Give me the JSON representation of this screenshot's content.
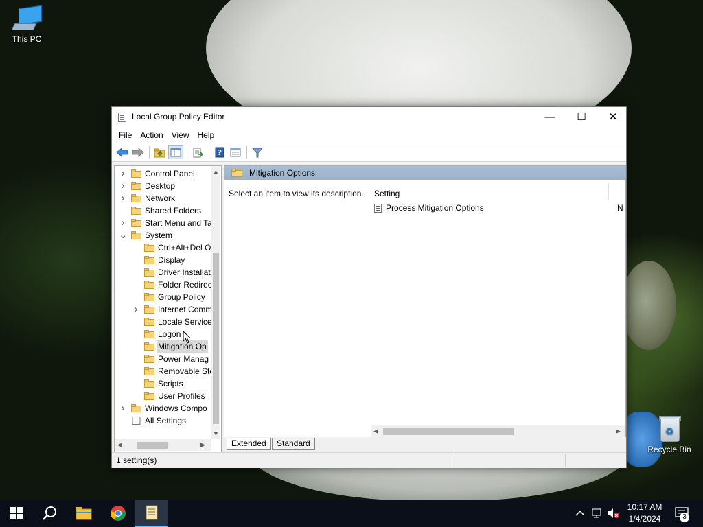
{
  "desktop": {
    "icons": [
      {
        "label": "This PC"
      },
      {
        "label": "Recycle Bin"
      }
    ]
  },
  "window": {
    "title": "Local Group Policy Editor",
    "caption_buttons": {
      "minimize": "—",
      "maximize": "☐",
      "close": "✕"
    },
    "menu": [
      "File",
      "Action",
      "View",
      "Help"
    ],
    "toolbar_icons": [
      "back-icon",
      "forward-icon",
      "up-folder-icon",
      "show-hide-tree-icon",
      "export-list-icon",
      "help-icon",
      "properties-view-icon",
      "filter-icon"
    ]
  },
  "tree": {
    "items": [
      {
        "label": "Control Panel",
        "level": 0,
        "expander": "collapsed"
      },
      {
        "label": "Desktop",
        "level": 0,
        "expander": "collapsed"
      },
      {
        "label": "Network",
        "level": 0,
        "expander": "collapsed"
      },
      {
        "label": "Shared Folders",
        "level": 0,
        "expander": "none"
      },
      {
        "label": "Start Menu and Ta",
        "level": 0,
        "expander": "collapsed"
      },
      {
        "label": "System",
        "level": 0,
        "expander": "expanded"
      },
      {
        "label": "Ctrl+Alt+Del O",
        "level": 1,
        "expander": "none"
      },
      {
        "label": "Display",
        "level": 1,
        "expander": "none"
      },
      {
        "label": "Driver Installati",
        "level": 1,
        "expander": "none"
      },
      {
        "label": "Folder Redirec",
        "level": 1,
        "expander": "none"
      },
      {
        "label": "Group Policy",
        "level": 1,
        "expander": "none"
      },
      {
        "label": "Internet Comm",
        "level": 1,
        "expander": "collapsed"
      },
      {
        "label": "Locale Service",
        "level": 1,
        "expander": "none"
      },
      {
        "label": "Logon",
        "level": 1,
        "expander": "none"
      },
      {
        "label": "Mitigation Op",
        "level": 1,
        "expander": "none",
        "selected": true
      },
      {
        "label": "Power Manag",
        "level": 1,
        "expander": "none"
      },
      {
        "label": "Removable Sto",
        "level": 1,
        "expander": "none"
      },
      {
        "label": "Scripts",
        "level": 1,
        "expander": "none"
      },
      {
        "label": "User Profiles",
        "level": 1,
        "expander": "none"
      },
      {
        "label": "Windows Compo",
        "level": 0,
        "expander": "collapsed"
      },
      {
        "label": "All Settings",
        "level": 0,
        "expander": "none",
        "icon": "settings-list"
      }
    ]
  },
  "content": {
    "header": "Mitigation Options",
    "description": "Select an item to view its description.",
    "column_setting": "Setting",
    "rows": [
      {
        "name": "Process Mitigation Options",
        "state": "N"
      }
    ]
  },
  "tabs": {
    "extended": "Extended",
    "standard": "Standard"
  },
  "status": {
    "text": "1 setting(s)"
  },
  "taskbar": {
    "clock_time": "10:17 AM",
    "clock_date": "1/4/2024",
    "notification_count": "3"
  }
}
